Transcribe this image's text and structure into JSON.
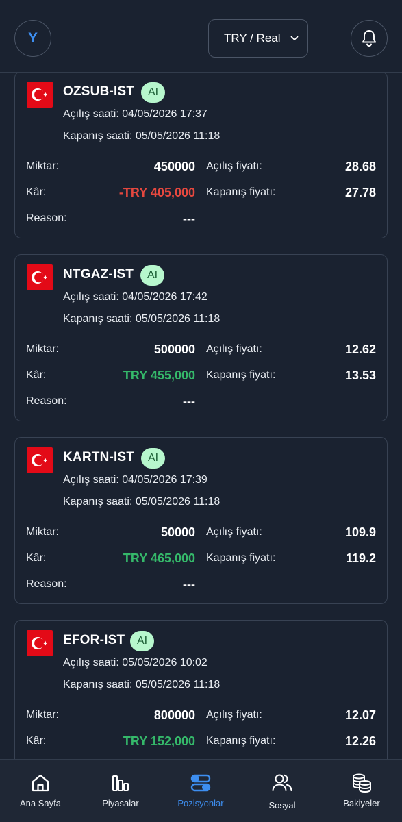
{
  "header": {
    "avatar_initial": "Y",
    "currency_label": "TRY / Real"
  },
  "labels": {
    "open_time": "Açılış saati:",
    "close_time": "Kapanış saati:",
    "quantity": "Miktar:",
    "profit": "Kâr:",
    "reason": "Reason:",
    "open_price": "Açılış fiyatı:",
    "close_price": "Kapanış fiyatı:"
  },
  "positions": [
    {
      "symbol": "OZSUB-IST",
      "badge": "AI",
      "open_time": "04/05/2026 17:37",
      "close_time": "05/05/2026 11:18",
      "quantity": "450000",
      "profit": "-TRY 405,000",
      "profit_positive": false,
      "reason": "---",
      "open_price": "28.68",
      "close_price": "27.78"
    },
    {
      "symbol": "NTGAZ-IST",
      "badge": "AI",
      "open_time": "04/05/2026 17:42",
      "close_time": "05/05/2026 11:18",
      "quantity": "500000",
      "profit": "TRY 455,000",
      "profit_positive": true,
      "reason": "---",
      "open_price": "12.62",
      "close_price": "13.53"
    },
    {
      "symbol": "KARTN-IST",
      "badge": "AI",
      "open_time": "04/05/2026 17:39",
      "close_time": "05/05/2026 11:18",
      "quantity": "50000",
      "profit": "TRY 465,000",
      "profit_positive": true,
      "reason": "---",
      "open_price": "109.9",
      "close_price": "119.2"
    },
    {
      "symbol": "EFOR-IST",
      "badge": "AI",
      "open_time": "05/05/2026 10:02",
      "close_time": "05/05/2026 11:18",
      "quantity": "800000",
      "profit": "TRY 152,000",
      "profit_positive": true,
      "reason": "---",
      "open_price": "12.07",
      "close_price": "12.26"
    }
  ],
  "nav": {
    "items": [
      {
        "label": "Ana Sayfa",
        "icon": "home-icon"
      },
      {
        "label": "Piyasalar",
        "icon": "bar-chart-icon"
      },
      {
        "label": "Pozisyonlar",
        "icon": "toggle-icon",
        "active": true
      },
      {
        "label": "Sosyal",
        "icon": "users-icon"
      },
      {
        "label": "Bakiyeler",
        "icon": "coins-icon"
      }
    ]
  },
  "colors": {
    "background": "#1a2230",
    "accent": "#3d8ef0",
    "profit_positive": "#35b86a",
    "profit_negative": "#e5483f",
    "badge_bg": "#b7f7cd"
  }
}
